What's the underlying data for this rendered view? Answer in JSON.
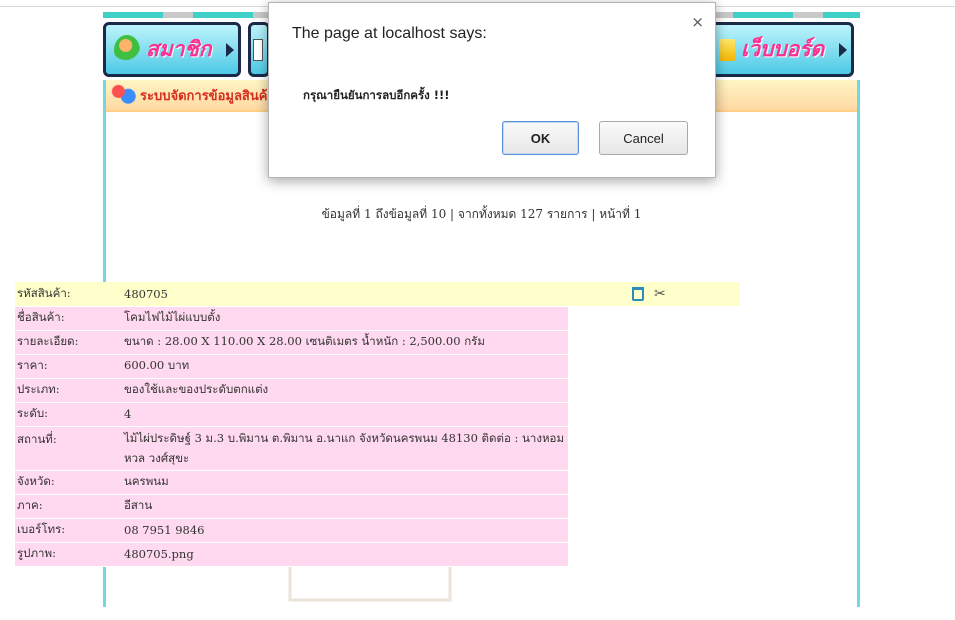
{
  "nav": {
    "member_label": "สมาชิก",
    "webboard_label": "เว็บบอร์ด"
  },
  "panel": {
    "heading": "ระบบจัดการข้อมูลสินค้า"
  },
  "pager_text": "ข้อมูลที่ 1 ถึงข้อมูลที่ 10 | จากทั้งหมด 127 รายการ | หน้าที่ 1",
  "product": {
    "rows": [
      {
        "label": "รหัสสินค้า:",
        "value": "480705"
      },
      {
        "label": "ชื่อสินค้า:",
        "value": "โคมไฟไม้ไผ่แบบตั้ง"
      },
      {
        "label": "รายละเอียด:",
        "value": "ขนาด : 28.00 X 110.00 X 28.00 เซนติเมตร น้ำหนัก : 2,500.00 กรัม"
      },
      {
        "label": "ราคา:",
        "value": "600.00 บาท"
      },
      {
        "label": "ประเภท:",
        "value": "ของใช้และของประดับตกแต่ง"
      },
      {
        "label": "ระดับ:",
        "value": "4"
      },
      {
        "label": "สถานที่:",
        "value": "ไม้ไผ่ประดิษฐ์ 3 ม.3 บ.พิมาน ต.พิมาน อ.นาแก จังหวัดนครพนม 48130 ติดต่อ : นางหอมหวล วงศ์สุขะ"
      },
      {
        "label": "จังหวัด:",
        "value": "นครพนม"
      },
      {
        "label": "ภาค:",
        "value": "อีสาน"
      },
      {
        "label": "เบอร์โทร:",
        "value": "08 7951 9846"
      },
      {
        "label": "รูปภาพ:",
        "value": "480705.png"
      }
    ]
  },
  "dialog": {
    "title": "The page at localhost says:",
    "message": "กรุณายืนยันการลบอีกครั้ง !!!",
    "ok_label": "OK",
    "cancel_label": "Cancel",
    "close_glyph": "×"
  },
  "colors": {
    "label_row_bg": "#ffd9ef",
    "header_row_bg": "#ffffcc",
    "heading_text": "#d4301f"
  }
}
